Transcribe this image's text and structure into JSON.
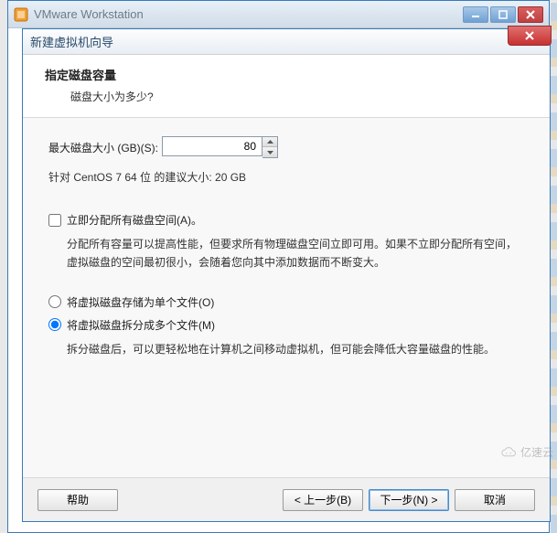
{
  "outer": {
    "title": "VMware Workstation"
  },
  "dialog": {
    "title": "新建虚拟机向导",
    "header_title": "指定磁盘容量",
    "header_subtitle": "磁盘大小为多少?"
  },
  "size": {
    "label": "最大磁盘大小 (GB)(S):",
    "value": "80",
    "recommend": "针对 CentOS 7 64 位 的建议大小: 20 GB"
  },
  "allocate": {
    "label": "立即分配所有磁盘空间(A)。",
    "desc": "分配所有容量可以提高性能，但要求所有物理磁盘空间立即可用。如果不立即分配所有空间，虚拟磁盘的空间最初很小，会随着您向其中添加数据而不断变大。"
  },
  "radios": {
    "single_label": "将虚拟磁盘存储为单个文件(O)",
    "split_label": "将虚拟磁盘拆分成多个文件(M)",
    "split_desc": "拆分磁盘后，可以更轻松地在计算机之间移动虚拟机，但可能会降低大容量磁盘的性能。"
  },
  "buttons": {
    "help": "帮助",
    "back": "< 上一步(B)",
    "next": "下一步(N) >",
    "cancel": "取消"
  },
  "watermark": "亿速云"
}
